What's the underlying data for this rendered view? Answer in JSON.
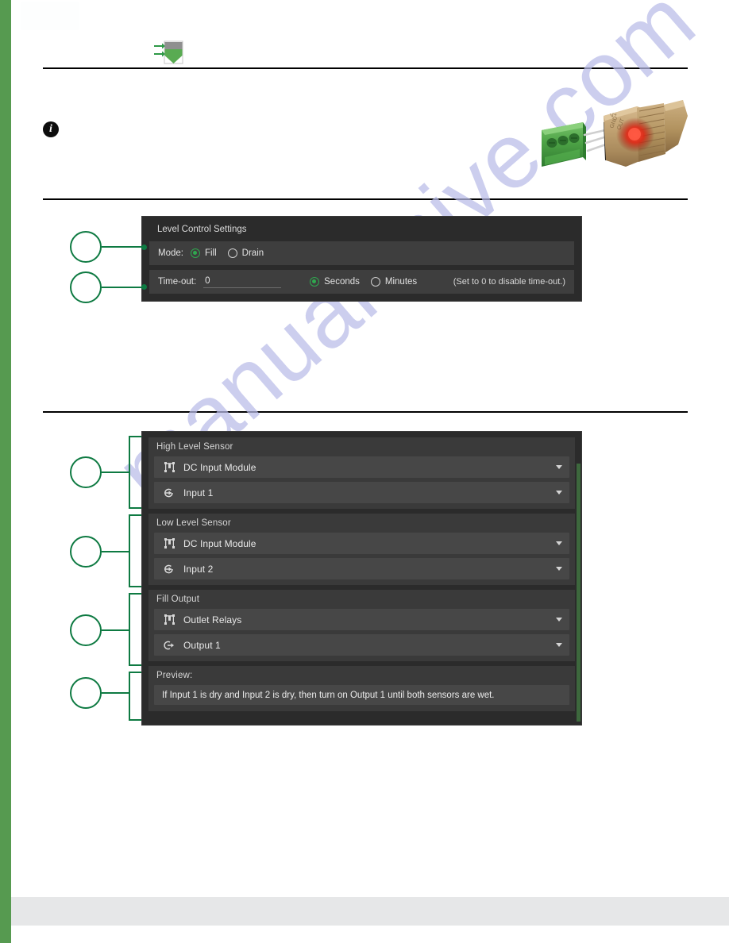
{
  "page": {
    "watermark": "manualshive.com",
    "accent_green": "#569a50",
    "callout_green": "#0e7a42",
    "panel_bg": "#2b2b2b",
    "select_bg": "#474747"
  },
  "icons": {
    "tank": "tank-fill-icon",
    "info": "info-icon",
    "info_glyph": "i",
    "sensor_photo": "liquid-level-sensor-photo",
    "module": "io-module-icon",
    "input": "input-arrow-icon",
    "output": "output-arrow-icon",
    "caret": "chevron-down-icon"
  },
  "level_control": {
    "title": "Level Control Settings",
    "mode": {
      "label": "Mode:",
      "options": [
        {
          "label": "Fill",
          "selected": true
        },
        {
          "label": "Drain",
          "selected": false
        }
      ]
    },
    "timeout": {
      "label": "Time-out:",
      "value": "0",
      "placeholder": "0",
      "units": [
        {
          "label": "Seconds",
          "selected": true
        },
        {
          "label": "Minutes",
          "selected": false
        }
      ],
      "hint": "(Set to 0 to disable time-out.)"
    }
  },
  "sensors": {
    "groups": [
      {
        "title": "High Level Sensor",
        "module_select": {
          "value": "DC Input Module",
          "icon": "io-module-icon"
        },
        "channel_select": {
          "value": "Input 1",
          "icon": "input-arrow-icon"
        }
      },
      {
        "title": "Low Level Sensor",
        "module_select": {
          "value": "DC Input Module",
          "icon": "io-module-icon"
        },
        "channel_select": {
          "value": "Input 2",
          "icon": "input-arrow-icon"
        }
      },
      {
        "title": "Fill Output",
        "module_select": {
          "value": "Outlet Relays",
          "icon": "io-module-icon"
        },
        "channel_select": {
          "value": "Output 1",
          "icon": "output-arrow-icon"
        }
      }
    ],
    "preview": {
      "title": "Preview:",
      "text": "If Input 1 is dry and Input 2 is dry, then turn on Output 1 until both sensors are wet."
    }
  },
  "callouts": {
    "level_panel": [
      {
        "id": "1",
        "target": "mode-row"
      },
      {
        "id": "2",
        "target": "timeout-row"
      }
    ],
    "sensor_panel": [
      {
        "id": "3",
        "target": "high-level-sensor-group"
      },
      {
        "id": "4",
        "target": "low-level-sensor-group"
      },
      {
        "id": "5",
        "target": "fill-output-group"
      },
      {
        "id": "6",
        "target": "preview-group"
      }
    ]
  }
}
